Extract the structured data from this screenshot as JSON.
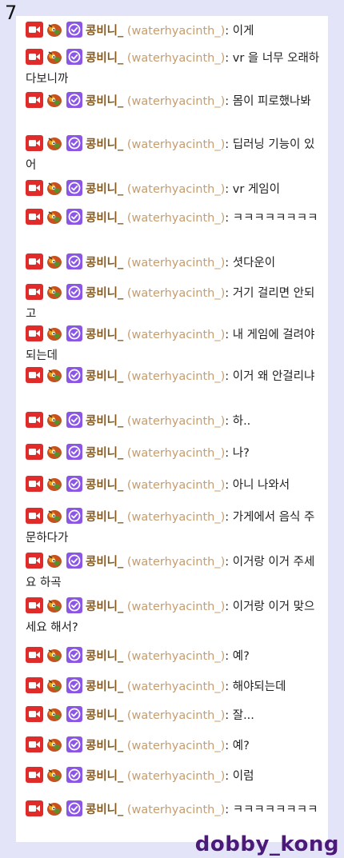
{
  "page_number": "7",
  "watermark": "dobby_kong",
  "colors": {
    "background": "#e4e4f8",
    "username": "#8a5a1c",
    "login": "#c59d6e",
    "broadcaster_badge": "#e02b2b",
    "verified_badge": "#8b55e6",
    "watermark": "#4b1a78"
  },
  "badges": [
    "broadcaster-camera-icon",
    "emote-badge-icon",
    "verified-check-icon"
  ],
  "chat": {
    "messages": [
      {
        "user": "콩비니_",
        "login": "(waterhyacinth_)",
        "sep": ":",
        "text": "이게"
      },
      {
        "user": "콩비니_",
        "login": "(waterhyacinth_)",
        "sep": ":",
        "text": "vr 을 너무 오래하다보니까"
      },
      {
        "user": "콩비니_",
        "login": "(waterhyacinth_)",
        "sep": ":",
        "text": "몸이 피로했나봐"
      },
      {
        "user": "콩비니_",
        "login": "(waterhyacinth_)",
        "sep": ":",
        "text": "딥러닝 기능이 있어"
      },
      {
        "user": "콩비니_",
        "login": "(waterhyacinth_)",
        "sep": ":",
        "text": "vr 게임이"
      },
      {
        "user": "콩비니_",
        "login": "(waterhyacinth_)",
        "sep": ":",
        "text": "ㅋㅋㅋㅋㅋㅋㅋㅋ"
      },
      {
        "user": "콩비니_",
        "login": "(waterhyacinth_)",
        "sep": ":",
        "text": "셧다운이"
      },
      {
        "user": "콩비니_",
        "login": "(waterhyacinth_)",
        "sep": ":",
        "text": "거기 걸리면 안되고"
      },
      {
        "user": "콩비니_",
        "login": "(waterhyacinth_)",
        "sep": ":",
        "text": "내 게임에 걸려야되는데"
      },
      {
        "user": "콩비니_",
        "login": "(waterhyacinth_)",
        "sep": ":",
        "text": "이거 왜 안걸리냐"
      },
      {
        "user": "콩비니_",
        "login": "(waterhyacinth_)",
        "sep": ":",
        "text": "하.."
      },
      {
        "user": "콩비니_",
        "login": "(waterhyacinth_)",
        "sep": ":",
        "text": "나?"
      },
      {
        "user": "콩비니_",
        "login": "(waterhyacinth_)",
        "sep": ":",
        "text": "아니 나와서"
      },
      {
        "user": "콩비니_",
        "login": "(waterhyacinth_)",
        "sep": ":",
        "text": "가게에서 음식 주문하다가"
      },
      {
        "user": "콩비니_",
        "login": "(waterhyacinth_)",
        "sep": ":",
        "text": "이거랑 이거 주세요 하곡"
      },
      {
        "user": "콩비니_",
        "login": "(waterhyacinth_)",
        "sep": ":",
        "text": "이거랑 이거 맞으세요 해서?"
      },
      {
        "user": "콩비니_",
        "login": "(waterhyacinth_)",
        "sep": ":",
        "text": "예?"
      },
      {
        "user": "콩비니_",
        "login": "(waterhyacinth_)",
        "sep": ":",
        "text": "해야되는데"
      },
      {
        "user": "콩비니_",
        "login": "(waterhyacinth_)",
        "sep": ":",
        "text": "잘..."
      },
      {
        "user": "콩비니_",
        "login": "(waterhyacinth_)",
        "sep": ":",
        "text": "예?"
      },
      {
        "user": "콩비니_",
        "login": "(waterhyacinth_)",
        "sep": ":",
        "text": "이럼"
      },
      {
        "user": "콩비니_",
        "login": "(waterhyacinth_)",
        "sep": ":",
        "text": "ㅋㅋㅋㅋㅋㅋㅋㅋ"
      }
    ]
  }
}
